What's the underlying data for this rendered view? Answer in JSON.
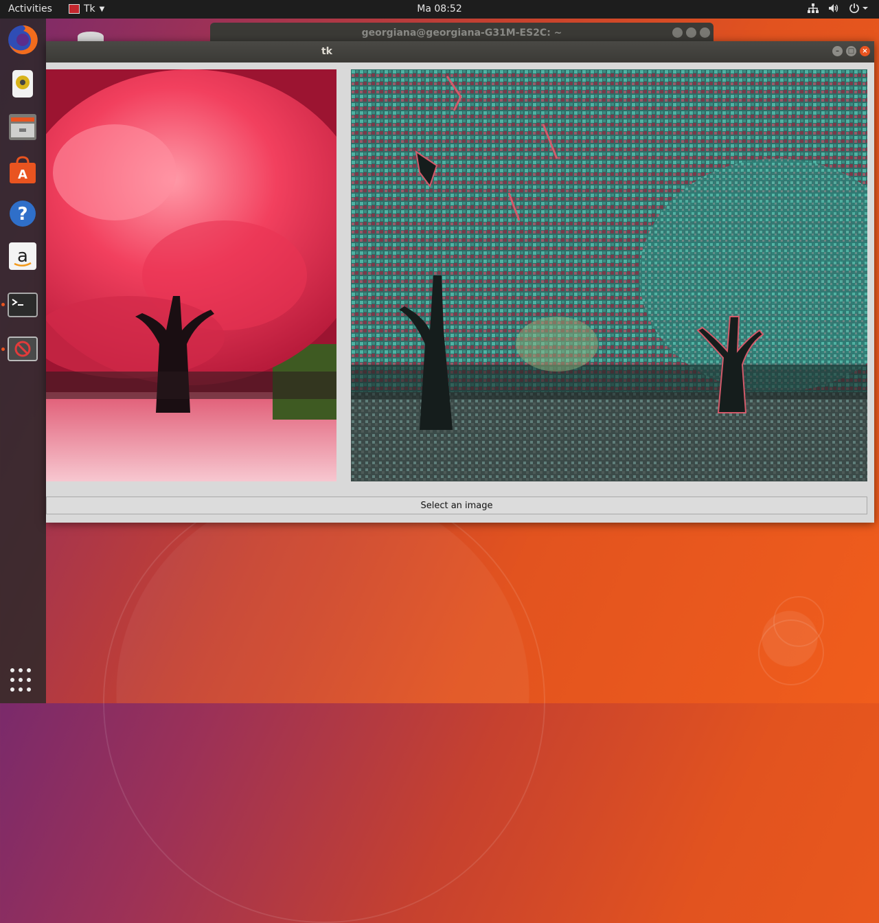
{
  "topbar": {
    "activities": "Activities",
    "app_name": "Tk",
    "clock": "Ma 08:52"
  },
  "dock": {
    "items": [
      "firefox-icon",
      "rhythmbox-icon",
      "files-icon",
      "software-center-icon",
      "help-icon",
      "amazon-icon",
      "terminal-icon",
      "tk-app-icon",
      "show-applications-icon"
    ]
  },
  "terminal_window": {
    "title": "georgiana@georgiana-G31M-ES2C: ~"
  },
  "tk_window": {
    "title": "tk",
    "select_button_label": "Select an image",
    "left_image_desc": "original",
    "right_image_desc": "processed"
  },
  "colors": {
    "accent": "#e95420",
    "panel": "#1d1d1d",
    "window_bg": "#d9d9d9"
  }
}
